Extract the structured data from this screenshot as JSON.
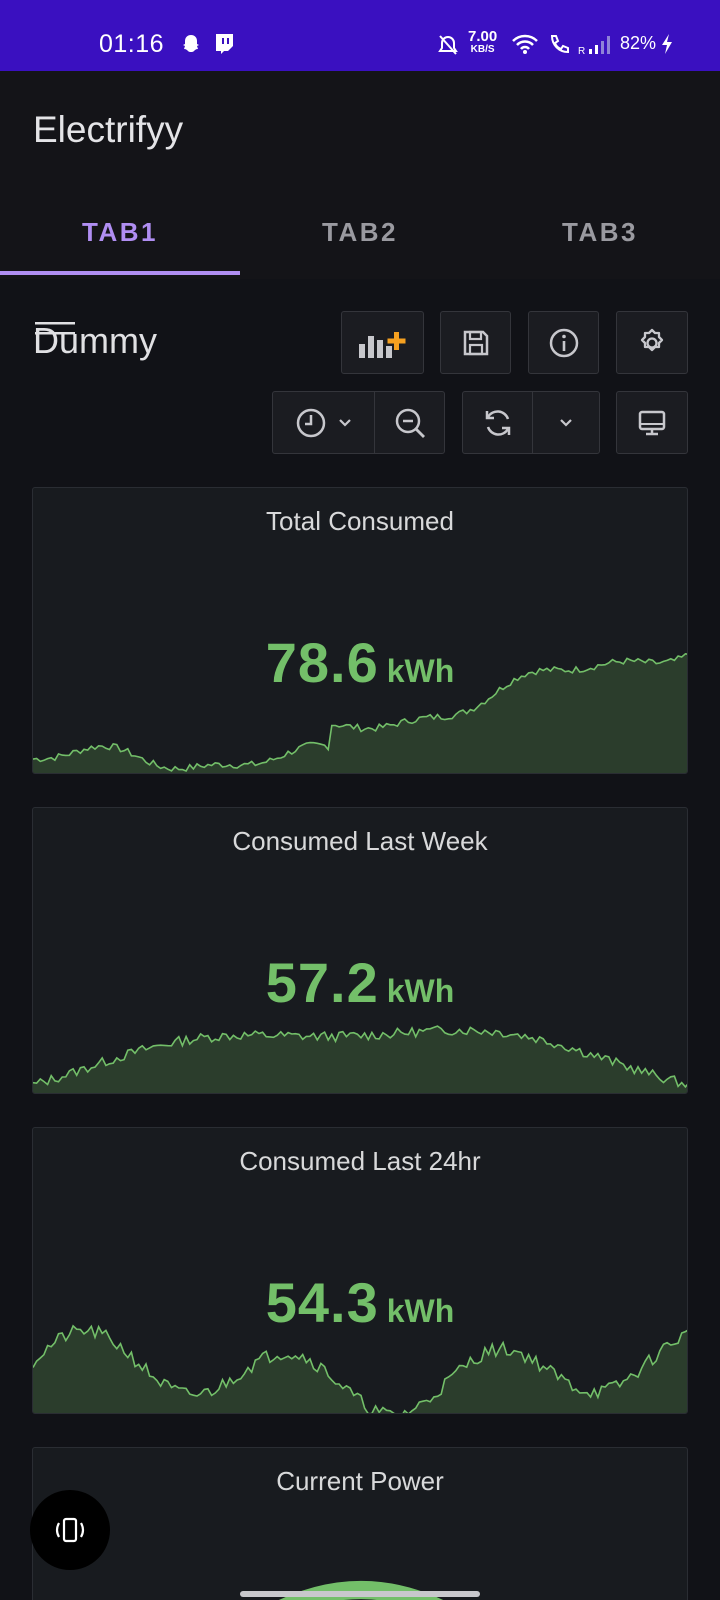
{
  "status_bar": {
    "time": "01:16",
    "speed_value": "7.00",
    "speed_unit": "KB/S",
    "battery": "82%"
  },
  "app": {
    "title": "Electrifyy"
  },
  "tabs": [
    {
      "label": "TAB1",
      "active": true
    },
    {
      "label": "TAB2",
      "active": false
    },
    {
      "label": "TAB3",
      "active": false
    }
  ],
  "dashboard": {
    "title": "Dummy",
    "toolbar_icons": [
      "add-panel-icon",
      "save-icon",
      "info-icon",
      "settings-icon",
      "clock-icon",
      "zoom-out-icon",
      "refresh-icon",
      "chevron-down-icon",
      "tv-mode-icon"
    ]
  },
  "panels": [
    {
      "title": "Total Consumed",
      "value": "78.6",
      "unit": "kWh"
    },
    {
      "title": "Consumed Last Week",
      "value": "57.2",
      "unit": "kWh"
    },
    {
      "title": "Consumed Last 24hr",
      "value": "54.3",
      "unit": "kWh"
    },
    {
      "title": "Current Power"
    }
  ],
  "colors": {
    "accent": "#b08ef2",
    "stat_green": "#73bf69",
    "status_bar": "#3a10c0",
    "add_icon_orange": "#f5a020"
  }
}
